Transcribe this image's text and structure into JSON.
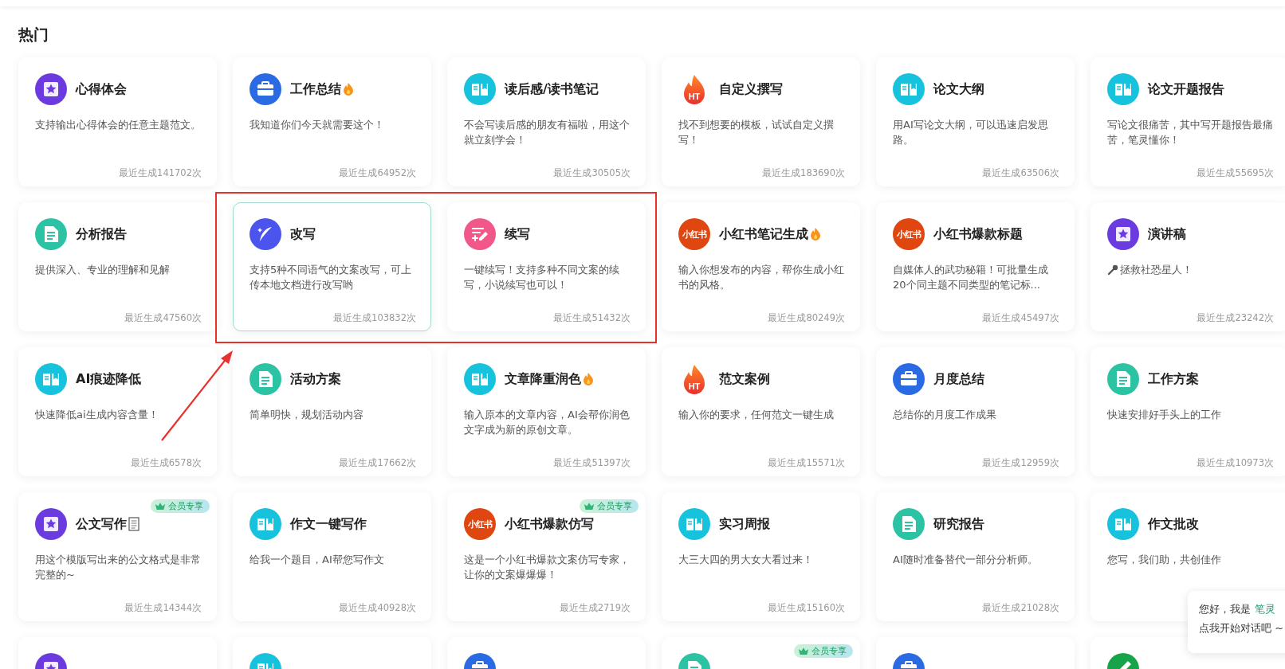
{
  "section_title": "热门",
  "cards": [
    {
      "icon": {
        "kind": "star"
      },
      "title": "心得体会",
      "desc": "支持输出心得体会的任意主题范文。",
      "count": "最近生成141702次",
      "selected": false
    },
    {
      "icon": {
        "kind": "briefcase"
      },
      "title": "工作总结",
      "title_icon": {
        "kind": "fire"
      },
      "desc": "我知道你们今天就需要这个！",
      "count": "最近生成64952次",
      "selected": false
    },
    {
      "icon": {
        "kind": "book"
      },
      "title": "读后感/读书笔记",
      "desc": "不会写读后感的朋友有福啦，用这个就立刻学会！",
      "count": "最近生成30505次",
      "selected": false
    },
    {
      "icon": {
        "kind": "flame",
        "text": "HT"
      },
      "title": "自定义撰写",
      "desc": "找不到想要的模板，试试自定义撰写！",
      "count": "最近生成183690次",
      "selected": false
    },
    {
      "icon": {
        "kind": "book"
      },
      "title": "论文大纲",
      "desc": "用AI写论文大纲，可以迅速启发思路。",
      "count": "最近生成63506次",
      "selected": false
    },
    {
      "icon": {
        "kind": "book"
      },
      "title": "论文开题报告",
      "desc": "写论文很痛苦，其中写开题报告最痛苦，笔灵懂你！",
      "count": "最近生成55695次",
      "selected": false
    },
    {
      "icon": {
        "kind": "document"
      },
      "title": "分析报告",
      "desc": "提供深入、专业的理解和见解",
      "count": "最近生成47560次",
      "selected": false
    },
    {
      "icon": {
        "kind": "quill"
      },
      "title": "改写",
      "desc": "支持5种不同语气的文案改写，可上传本地文档进行改写哟",
      "count": "最近生成103832次",
      "selected": true
    },
    {
      "icon": {
        "kind": "pen"
      },
      "title": "续写",
      "desc": "一键续写！支持多种不同文案的续写，小说续写也可以！",
      "count": "最近生成51432次",
      "selected": false
    },
    {
      "icon": {
        "kind": "logo",
        "text": "小红书"
      },
      "title": "小红书笔记生成",
      "title_icon": {
        "kind": "fire"
      },
      "desc": "输入你想发布的内容，帮你生成小红书的风格。",
      "count": "最近生成80249次",
      "selected": false
    },
    {
      "icon": {
        "kind": "logo",
        "text": "小红书"
      },
      "title": "小红书爆款标题",
      "desc": "自媒体人的武功秘籍！可批量生成20个同主题不同类型的笔记标...",
      "count": "最近生成45497次",
      "selected": false
    },
    {
      "icon": {
        "kind": "star"
      },
      "title": "演讲稿",
      "desc_icon": {
        "kind": "microphone"
      },
      "desc": "拯救社恐星人！",
      "count": "最近生成23242次",
      "selected": false
    },
    {
      "icon": {
        "kind": "book"
      },
      "title": "AI痕迹降低",
      "desc": "快速降低ai生成内容含量！",
      "count": "最近生成6578次",
      "selected": false
    },
    {
      "icon": {
        "kind": "document"
      },
      "title": "活动方案",
      "desc": "简单明快，规划活动内容",
      "count": "最近生成17662次",
      "selected": false
    },
    {
      "icon": {
        "kind": "book"
      },
      "title": "文章降重润色",
      "title_icon": {
        "kind": "fire"
      },
      "desc": "输入原本的文章内容，AI会帮你润色文字成为新的原创文章。",
      "count": "最近生成51397次",
      "selected": false
    },
    {
      "icon": {
        "kind": "flame",
        "text": "HT"
      },
      "title": "范文案例",
      "desc": "输入你的要求，任何范文一键生成",
      "count": "最近生成15571次",
      "selected": false
    },
    {
      "icon": {
        "kind": "briefcase"
      },
      "title": "月度总结",
      "desc": "总结你的月度工作成果",
      "count": "最近生成12959次",
      "selected": false
    },
    {
      "icon": {
        "kind": "document"
      },
      "title": "工作方案",
      "desc": "快速安排好手头上的工作",
      "count": "最近生成10973次",
      "selected": false
    },
    {
      "icon": {
        "kind": "star"
      },
      "title": "公文写作",
      "title_icon": {
        "kind": "page"
      },
      "badge": "会员专享",
      "desc": "用这个模版写出来的公文格式是非常完整的~",
      "count": "最近生成14344次",
      "selected": false
    },
    {
      "icon": {
        "kind": "book"
      },
      "title": "作文一键写作",
      "desc": "给我一个题目，AI帮您写作文",
      "count": "最近生成40928次",
      "selected": false
    },
    {
      "icon": {
        "kind": "logo",
        "text": "小红书"
      },
      "title": "小红书爆款仿写",
      "badge": "会员专享",
      "desc": "这是一个小红书爆款文案仿写专家，让你的文案爆爆爆！",
      "count": "最近生成2719次",
      "selected": false
    },
    {
      "icon": {
        "kind": "book"
      },
      "title": "实习周报",
      "desc": "大三大四的男大女大看过来！",
      "count": "最近生成15160次",
      "selected": false
    },
    {
      "icon": {
        "kind": "document"
      },
      "title": "研究报告",
      "desc": "AI随时准备替代一部分分析师。",
      "count": "最近生成21028次",
      "selected": false
    },
    {
      "icon": {
        "kind": "book"
      },
      "title": "作文批改",
      "desc": "您写，我们助，共创佳作",
      "selected": false
    },
    {
      "icon": {
        "kind": "star"
      },
      "selected": false
    },
    {
      "icon": {
        "kind": "book"
      },
      "selected": false
    },
    {
      "icon": {
        "kind": "briefcase"
      },
      "selected": false
    },
    {
      "icon": {
        "kind": "document"
      },
      "badge": "会员专享",
      "selected": false
    },
    {
      "icon": {
        "kind": "briefcase"
      },
      "selected": false
    },
    {
      "icon": {
        "kind": "pencil"
      },
      "selected": false
    }
  ],
  "annotation": {
    "shown": true
  },
  "chat_popup": {
    "greeting": "您好，我是",
    "name": "笔灵",
    "prompt": "点我开始对话吧 ~"
  }
}
